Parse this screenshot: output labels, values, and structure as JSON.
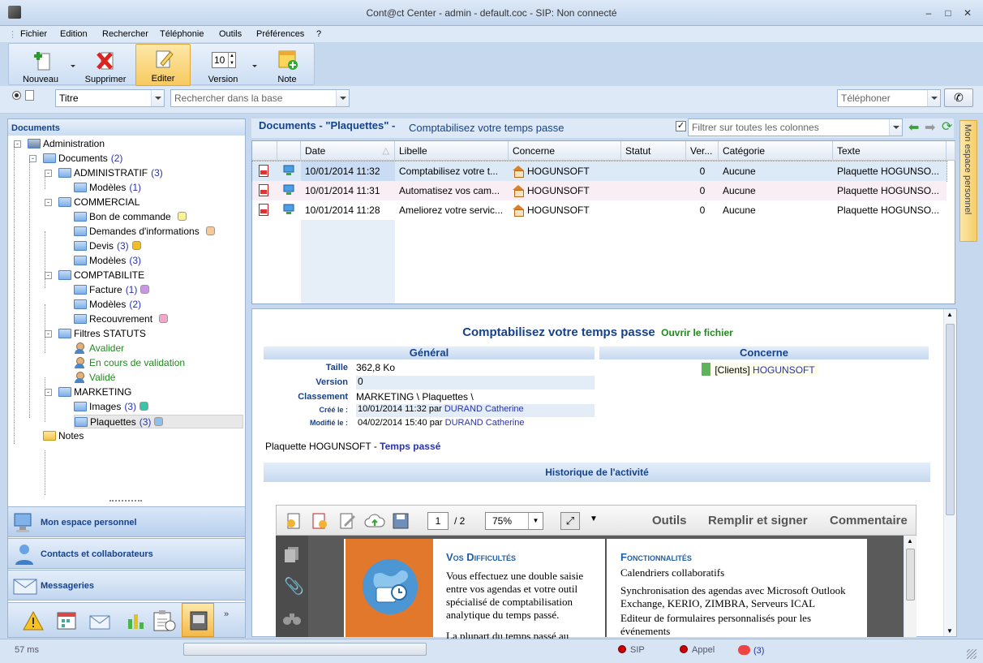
{
  "window": {
    "title": "Cont@ct Center - admin - default.coc - SIP: Non connecté"
  },
  "menu": [
    "Fichier",
    "Edition",
    "Rechercher",
    "Téléphonie",
    "Outils",
    "Préférences",
    "?"
  ],
  "toolbar": {
    "nouveau": "Nouveau",
    "supprimer": "Supprimer",
    "editer": "Editer",
    "version": "Version",
    "version_value": "10",
    "note": "Note"
  },
  "search": {
    "field": "Titre",
    "query_placeholder": "Rechercher dans la base",
    "phone_placeholder": "Téléphoner"
  },
  "left": {
    "header": "Documents",
    "tree": [
      {
        "label": "Administration",
        "count": "",
        "color": ""
      },
      {
        "label": "Documents",
        "count": "(2)",
        "color": ""
      },
      {
        "label": "ADMINISTRATIF",
        "count": "(3)",
        "color": ""
      },
      {
        "label": "Modèles",
        "count": "(1)",
        "color": ""
      },
      {
        "label": "COMMERCIAL",
        "count": "",
        "color": ""
      },
      {
        "label": "Bon de commande",
        "count": "",
        "color": "#fbf29a"
      },
      {
        "label": "Demandes d'informations",
        "count": "",
        "color": "#f6c896"
      },
      {
        "label": "Devis",
        "count": "(3)",
        "color": "#f2bb2a"
      },
      {
        "label": "Modèles",
        "count": "(3)",
        "color": ""
      },
      {
        "label": "COMPTABILITE",
        "count": "",
        "color": ""
      },
      {
        "label": "Facture",
        "count": "(1)",
        "color": "#c996e6"
      },
      {
        "label": "Modèles",
        "count": "(2)",
        "color": ""
      },
      {
        "label": "Recouvrement",
        "count": "",
        "color": "#f3a6c6"
      },
      {
        "label": "Filtres STATUTS",
        "count": "",
        "color": ""
      },
      {
        "label": "Avalider",
        "count": "",
        "color": ""
      },
      {
        "label": "En cours de validation",
        "count": "",
        "color": ""
      },
      {
        "label": "Validé",
        "count": "",
        "color": ""
      },
      {
        "label": "MARKETING",
        "count": "",
        "color": ""
      },
      {
        "label": "Images",
        "count": "(3)",
        "color": "#38c4a8"
      },
      {
        "label": "Plaquettes",
        "count": "(3)",
        "color": "#8ec0ee"
      },
      {
        "label": "Notes",
        "count": "",
        "color": ""
      }
    ],
    "nav": {
      "espace": "Mon espace personnel",
      "contacts": "Contacts et collaborateurs",
      "messageries": "Messageries"
    }
  },
  "main": {
    "header_title": "Documents - \"Plaquettes\" -",
    "header_sub": "Comptabilisez votre temps passe",
    "filter_placeholder": "Filtrer sur toutes les colonnes",
    "columns": [
      "Date",
      "Libelle",
      "Concerne",
      "Statut",
      "Ver...",
      "Catégorie",
      "Texte"
    ],
    "rows": [
      {
        "date": "10/01/2014 11:32",
        "libelle": "Comptabilisez votre t...",
        "concerne": "HOGUNSOFT",
        "statut": "",
        "version": "0",
        "categorie": "Aucune",
        "texte": "Plaquette HOGUNSO..."
      },
      {
        "date": "10/01/2014 11:31",
        "libelle": "Automatisez vos cam...",
        "concerne": "HOGUNSOFT",
        "statut": "",
        "version": "0",
        "categorie": "Aucune",
        "texte": "Plaquette HOGUNSO..."
      },
      {
        "date": "10/01/2014 11:28",
        "libelle": "Ameliorez votre servic...",
        "concerne": "HOGUNSOFT",
        "statut": "",
        "version": "0",
        "categorie": "Aucune",
        "texte": "Plaquette HOGUNSO..."
      }
    ]
  },
  "detail": {
    "title": "Comptabilisez votre temps passe",
    "open_link": "Ouvrir le fichier",
    "general": "Général",
    "concerne": "Concerne",
    "taille_label": "Taille",
    "taille": "362,8 Ko",
    "version_label": "Version",
    "version": "0",
    "classement_label": "Classement",
    "classement": "MARKETING \\ Plaquettes \\",
    "cree_label": "Créé le :",
    "cree_date": "10/01/2014 11:32 par",
    "cree_by": "DURAND Catherine",
    "modifie_label": "Modifié le :",
    "modifie_date": "04/02/2014 15:40 par",
    "modifie_by": "DURAND Catherine",
    "concerne_prefix": "[Clients]",
    "concerne_name": "HOGUNSOFT",
    "text_prefix": "Plaquette HOGUNSOFT -",
    "text_link": "Temps passé",
    "historique": "Historique de l'activité"
  },
  "pdf": {
    "page": "1",
    "pages": "/  2",
    "zoom": "75%",
    "outils": "Outils",
    "remplir": "Remplir et signer",
    "commentaire": "Commentaire",
    "col1_title": "Vos Difficultés",
    "col1_text": "Vous effectuez une double saisie entre vos agendas et votre outil spécialisé de comptabilisation analytique du temps passé.",
    "col1_text2": "La plupart du temps passé au",
    "col2_title": "Fonctionnalités",
    "col2_items": [
      "Calendriers collaboratifs",
      "Synchronisation des agendas avec Microsoft Outlook Exchange, KERIO, ZIMBRA, Serveurs ICAL",
      "Editeur de formulaires personnalisés pour les événements"
    ]
  },
  "right_tab": "Mon espace personnel",
  "status": {
    "ms": "57 ms",
    "sip": "SIP",
    "appel": "Appel",
    "count": "(3)"
  }
}
